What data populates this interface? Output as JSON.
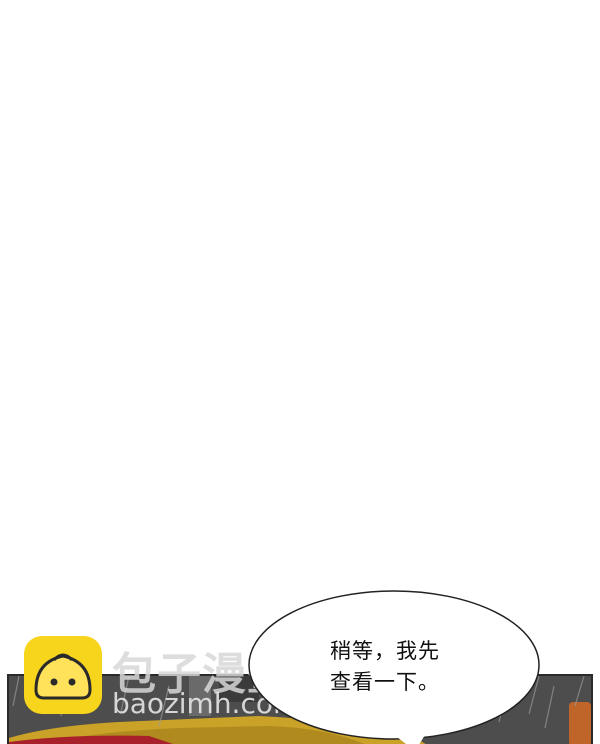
{
  "watermark": {
    "site_name": "包子漫畫",
    "url": "baozimh.com",
    "logo_icon": "bun-face-icon",
    "logo_color": "#f7d51d"
  },
  "speech_bubble": {
    "lines": [
      "稍等，我先",
      "查看一下。"
    ]
  },
  "colors": {
    "background": "#ffffff",
    "panel_dark": "#4f4f4f",
    "car_yellow": "#c9a227",
    "car_red": "#a8202a"
  }
}
